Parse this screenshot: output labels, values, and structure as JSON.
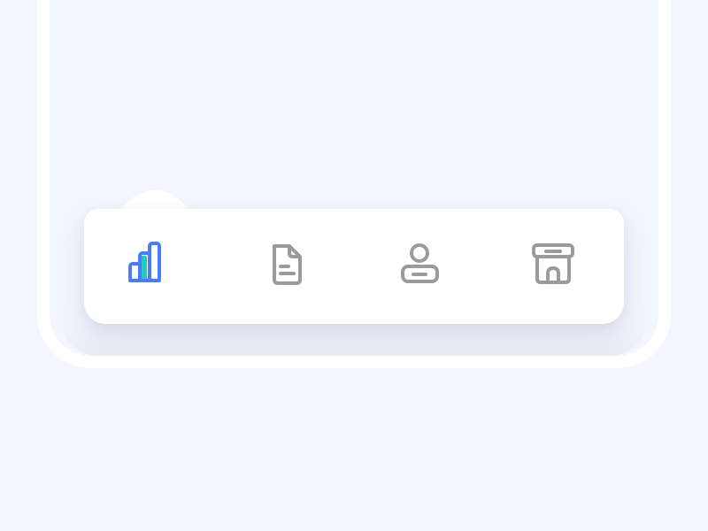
{
  "colors": {
    "background": "#f3f6fe",
    "frame": "#ffffff",
    "tab_bar": "#ffffff",
    "active_primary": "#4a7cf6",
    "active_accent": "#21c9c4",
    "inactive_icon": "#9b9b9b"
  },
  "tab_bar": {
    "active_index": 0,
    "items": [
      {
        "icon": "bar-chart-icon",
        "state": "active"
      },
      {
        "icon": "document-icon",
        "state": "inactive"
      },
      {
        "icon": "user-icon",
        "state": "inactive"
      },
      {
        "icon": "store-icon",
        "state": "inactive"
      }
    ]
  }
}
